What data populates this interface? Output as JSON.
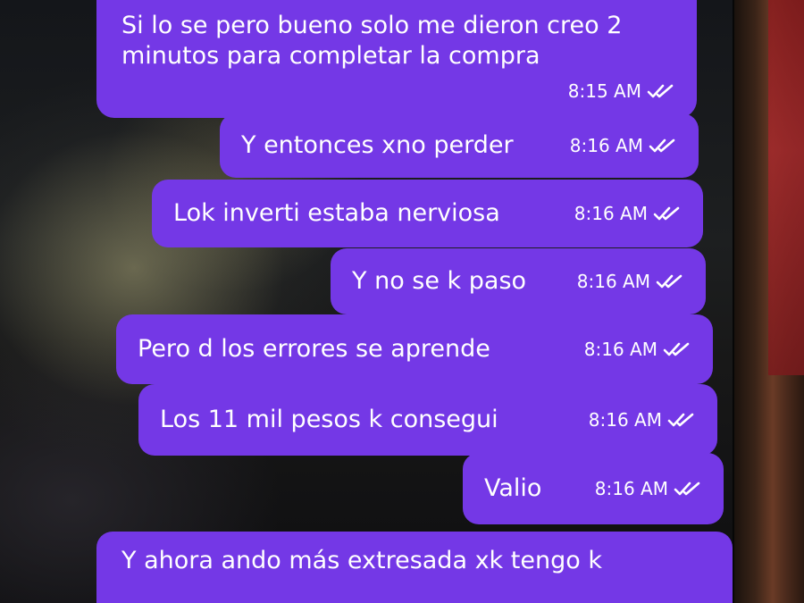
{
  "chat": {
    "messages": [
      {
        "text": "Si lo se pero bueno solo me dieron creo 2 minutos para completar la compra",
        "time": "8:15 AM",
        "status_icon": "double-check-icon"
      },
      {
        "text": "Y entonces xno perder",
        "time": "8:16 AM",
        "status_icon": "double-check-icon"
      },
      {
        "text": "Lok inverti estaba nerviosa",
        "time": "8:16 AM",
        "status_icon": "double-check-icon"
      },
      {
        "text": "Y no se k paso",
        "time": "8:16 AM",
        "status_icon": "double-check-icon"
      },
      {
        "text": "Pero d los errores se aprende",
        "time": "8:16 AM",
        "status_icon": "double-check-icon"
      },
      {
        "text": "Los 11 mil pesos k consegui",
        "time": "8:16 AM",
        "status_icon": "double-check-icon"
      },
      {
        "text": "Valio",
        "time": "8:16 AM",
        "status_icon": "double-check-icon"
      },
      {
        "text": "Y ahora ando más extresada xk tengo k",
        "time": "",
        "status_icon": ""
      }
    ]
  },
  "colors": {
    "bubble": "#7438e6",
    "text": "#ffffff"
  }
}
